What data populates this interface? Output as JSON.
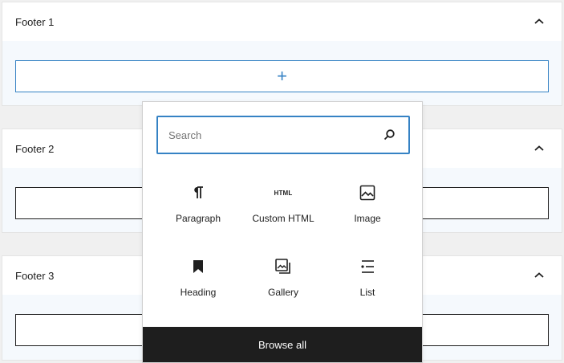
{
  "panels": [
    {
      "title": "Footer 1"
    },
    {
      "title": "Footer 2"
    },
    {
      "title": "Footer 3"
    }
  ],
  "appender": {
    "glyph": "+"
  },
  "inserter": {
    "search_placeholder": "Search",
    "blocks": [
      {
        "label": "Paragraph",
        "icon": "paragraph-icon"
      },
      {
        "label": "Custom HTML",
        "icon": "html-icon",
        "icon_text": "HTML"
      },
      {
        "label": "Image",
        "icon": "image-icon"
      },
      {
        "label": "Heading",
        "icon": "heading-icon"
      },
      {
        "label": "Gallery",
        "icon": "gallery-icon"
      },
      {
        "label": "List",
        "icon": "list-icon"
      }
    ],
    "browse_all": "Browse all"
  },
  "colors": {
    "accent": "#3582c4",
    "browse_bg": "#1e1e1e",
    "panel_bg": "#f5f9fd"
  }
}
